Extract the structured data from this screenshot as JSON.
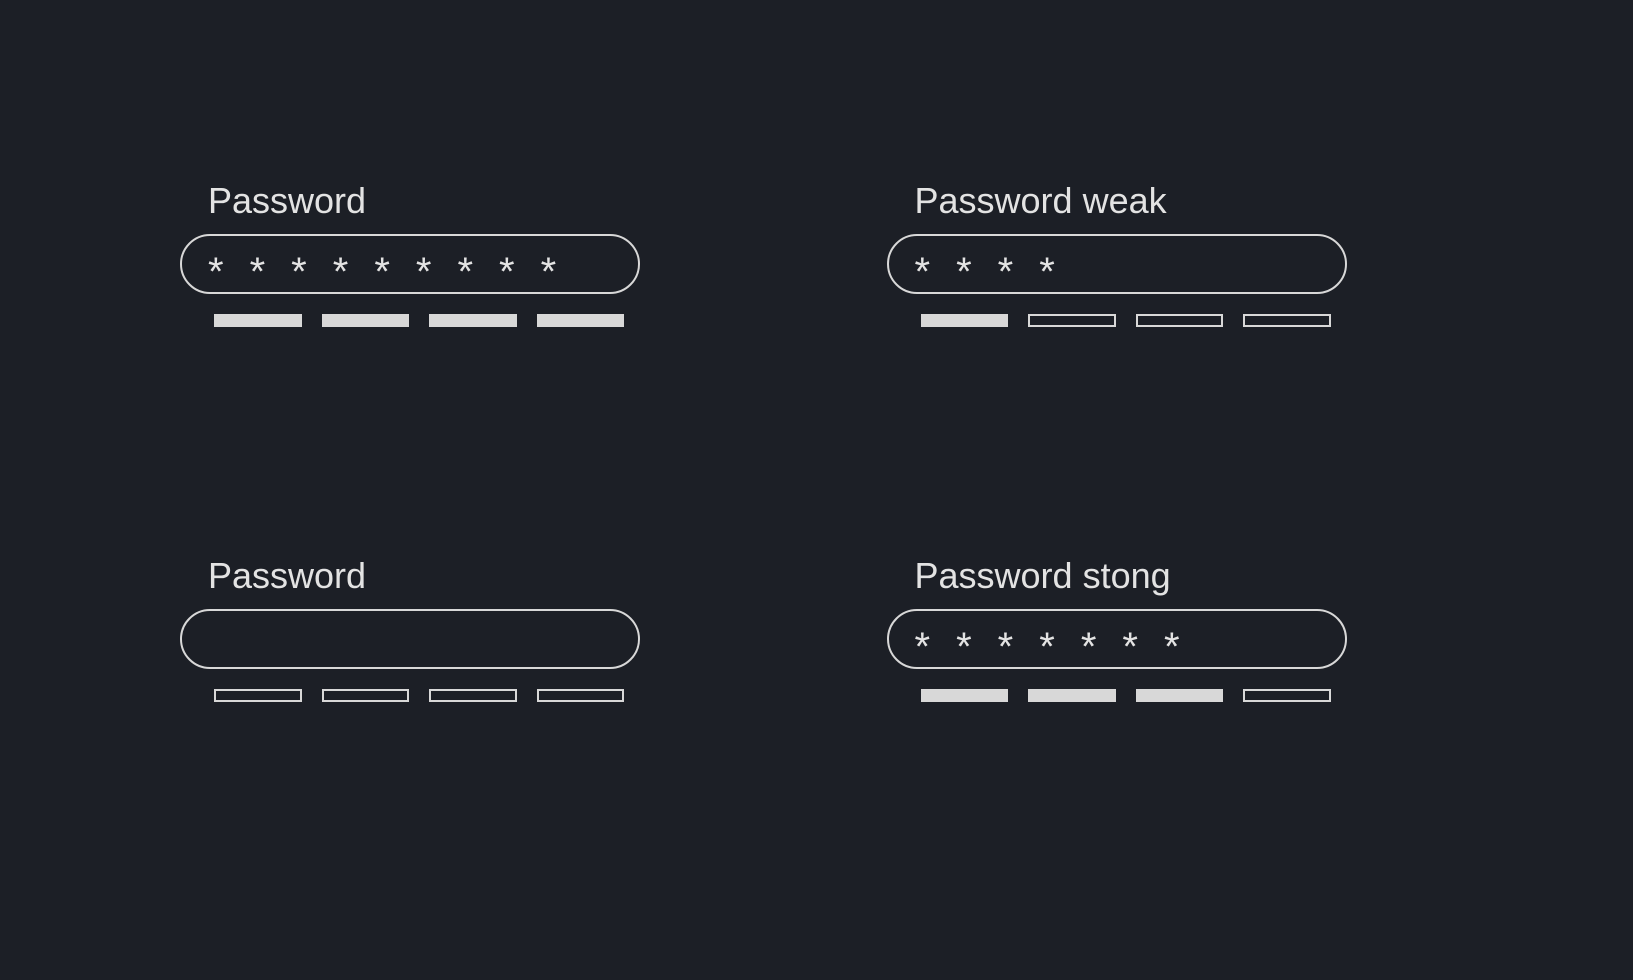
{
  "fields": {
    "full": {
      "label": "Password",
      "mask_count": 9,
      "segments": [
        "filled",
        "filled",
        "filled",
        "filled"
      ]
    },
    "weak": {
      "label": "Password weak",
      "mask_count": 4,
      "segments": [
        "filled",
        "empty",
        "empty",
        "empty"
      ]
    },
    "empty": {
      "label": "Password",
      "mask_count": 0,
      "segments": [
        "empty",
        "empty",
        "empty",
        "empty"
      ]
    },
    "strong": {
      "label": "Password stong",
      "mask_count": 7,
      "segments": [
        "filled",
        "filled",
        "filled",
        "empty"
      ]
    }
  },
  "mask_char": "*",
  "colors": {
    "background": "#1c1f26",
    "foreground": "#e3e3e3",
    "border": "#d8d8d8"
  }
}
